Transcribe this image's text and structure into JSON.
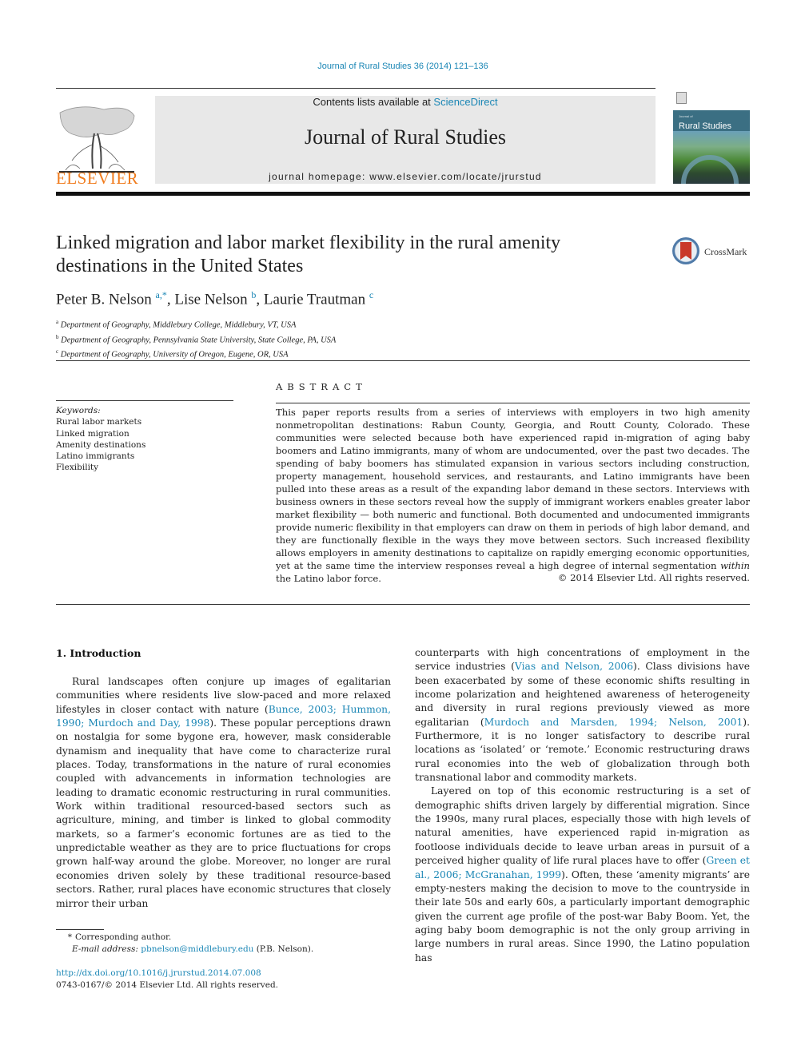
{
  "header": {
    "journal_citation": "Journal of Rural Studies 36 (2014) 121–136",
    "contents_prefix": "Contents lists available at ",
    "contents_link": "ScienceDirect",
    "journal_title": "Journal of Rural Studies",
    "homepage_line": "journal homepage: www.elsevier.com/locate/jrurstud",
    "publisher": "ELSEVIER",
    "cover_small_text": "Journal of",
    "cover_title": "Rural Studies",
    "crossmark_label": "CrossMark",
    "colors": {
      "link": "#1a86b5",
      "elsevier_orange": "#f07b1c",
      "masthead_bg": "#e8e8e8"
    }
  },
  "article": {
    "title": "Linked migration and labor market flexibility in the rural amenity destinations in the United States",
    "authors": [
      {
        "name": "Peter B. Nelson",
        "sup": "a,*"
      },
      {
        "name": "Lise Nelson",
        "sup": "b"
      },
      {
        "name": "Laurie Trautman",
        "sup": "c"
      }
    ],
    "affiliations": [
      {
        "mark": "a",
        "text": "Department of Geography, Middlebury College, Middlebury, VT, USA"
      },
      {
        "mark": "b",
        "text": "Department of Geography, Pennsylvania State University, State College, PA, USA"
      },
      {
        "mark": "c",
        "text": "Department of Geography, University of Oregon, Eugene, OR, USA"
      }
    ]
  },
  "keywords": {
    "heading": "Keywords:",
    "items": [
      "Rural labor markets",
      "Linked migration",
      "Amenity destinations",
      "Latino immigrants",
      "Flexibility"
    ]
  },
  "abstract": {
    "heading": "ABSTRACT",
    "text_before_italic": "This paper reports results from a series of interviews with employers in two high amenity nonmetropolitan destinations: Rabun County, Georgia, and Routt County, Colorado. These communities were selected because both have experienced rapid in-migration of aging baby boomers and Latino immigrants, many of whom are undocumented, over the past two decades. The spending of baby boomers has stimulated expansion in various sectors including construction, property management, household services, and restaurants, and Latino immigrants have been pulled into these areas as a result of the expanding labor demand in these sectors. Interviews with business owners in these sectors reveal how the supply of immigrant workers enables greater labor market flexibility — both numeric and functional. Both documented and undocumented immigrants provide numeric flexibility in that employers can draw on them in periods of high labor demand, and they are functionally flexible in the ways they move between sectors. Such increased flexibility allows employers in amenity destinations to capitalize on rapidly emerging economic opportunities, yet at the same time the interview responses reveal a high degree of internal segmentation ",
    "italic_word": "within",
    "text_after_italic": " the Latino labor force.",
    "copyright": "© 2014 Elsevier Ltd. All rights reserved."
  },
  "body": {
    "section_heading": "1.  Introduction",
    "left_column": {
      "p1_a": "Rural landscapes often conjure up images of egalitarian communities where residents live slow-paced and more relaxed lifestyles in closer contact with nature (",
      "p1_cite1": "Bunce, 2003; Hummon, 1990; Murdoch and Day, 1998",
      "p1_b": "). These popular perceptions drawn on nostalgia for some bygone era, however, mask considerable dynamism and inequality that have come to characterize rural places. Today, transformations in the nature of rural economies coupled with advancements in information technologies are leading to dramatic economic restructuring in rural communities. Work within traditional resourced-based sectors such as agriculture, mining, and timber is linked to global commodity markets, so a farmer’s economic fortunes are as tied to the unpredictable weather as they are to price fluctuations for crops grown half-way around the globe. Moreover, no longer are rural economies driven solely by these traditional resource-based sectors. Rather, rural places have economic structures that closely mirror their urban"
    },
    "right_column": {
      "p1_a": "counterparts with high concentrations of employment in the service industries (",
      "p1_cite1": "Vias and Nelson, 2006",
      "p1_b": "). Class divisions have been exacerbated by some of these economic shifts resulting in income polarization and heightened awareness of heterogeneity and diversity in rural regions previously viewed as more egalitarian (",
      "p1_cite2": "Murdoch and Marsden, 1994; Nelson, 2001",
      "p1_c": "). Furthermore, it is no longer satisfactory to describe rural locations as ‘isolated’ or ‘remote.’ Economic restructuring draws rural economies into the web of globalization through both transnational labor and commodity markets.",
      "p2_a": "Layered on top of this economic restructuring is a set of demographic shifts driven largely by differential migration. Since the 1990s, many rural places, especially those with high levels of natural amenities, have experienced rapid in-migration as footloose individuals decide to leave urban areas in pursuit of a perceived higher quality of life rural places have to offer (",
      "p2_cite1": "Green et al., 2006; McGranahan, 1999",
      "p2_b": "). Often, these ‘amenity migrants’ are empty-nesters making the decision to move to the countryside in their late 50s and early 60s, a particularly important demographic given the current age profile of the post-war Baby Boom. Yet, the aging baby boom demographic is not the only group arriving in large numbers in rural areas. Since 1990, the Latino population has"
    }
  },
  "footer": {
    "corresponding_mark": "*",
    "corresponding_text": "Corresponding author.",
    "email_label": "E-mail address:",
    "email": "pbnelson@middlebury.edu",
    "email_suffix": " (P.B. Nelson).",
    "doi": "http://dx.doi.org/10.1016/j.jrurstud.2014.07.008",
    "issn_line": "0743-0167/© 2014 Elsevier Ltd. All rights reserved."
  }
}
